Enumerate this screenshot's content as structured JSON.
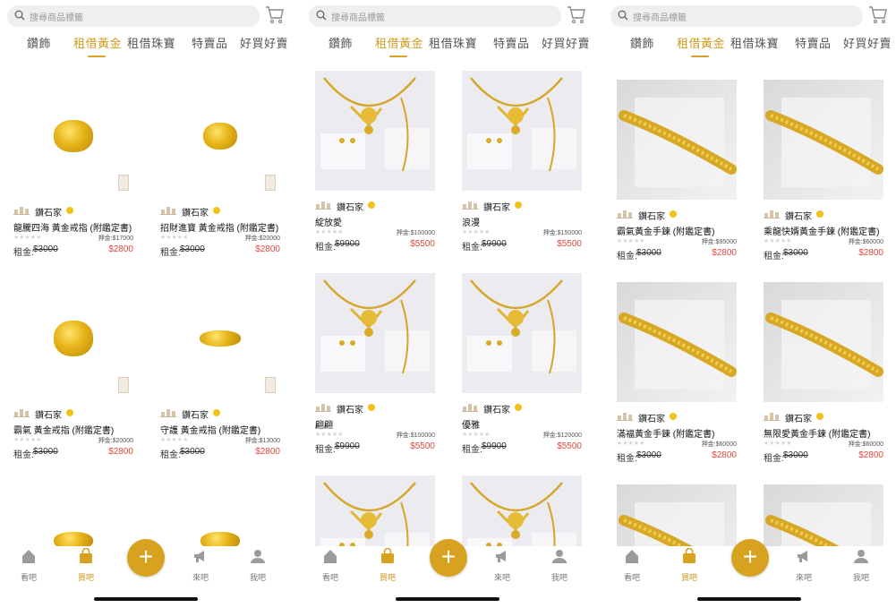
{
  "search": {
    "placeholder": "搜尋商品標籤"
  },
  "tabs": [
    "鑽飾",
    "租借黃金",
    "租借珠寶",
    "特賣品",
    "好買好賣"
  ],
  "active_tab_index": 1,
  "nav": {
    "items": [
      "看吧",
      "買吧",
      "來吧",
      "我吧"
    ],
    "fab_label": "+",
    "active_index": 1
  },
  "labels": {
    "rent": "租金:",
    "deposit_prefix": "押金:"
  },
  "colors": {
    "accent": "#d7a21f",
    "price_new": "#e0473f"
  },
  "panels": [
    {
      "cards": [
        {
          "shop": "鑽石家",
          "name": "龍騰四海 黃金戒指 (附鑑定書)",
          "deposit": "押金:$17000",
          "old_price": "$3000",
          "new_price": "$2800"
        },
        {
          "shop": "鑽石家",
          "name": "招財進寶 黃金戒指 (附鑑定書)",
          "deposit": "押金:$20000",
          "old_price": "$3000",
          "new_price": "$2800"
        },
        {
          "shop": "鑽石家",
          "name": "霸氣 黃金戒指 (附鑑定書)",
          "deposit": "押金:$20000",
          "old_price": "$3000",
          "new_price": "$2800"
        },
        {
          "shop": "鑽石家",
          "name": "守護 黃金戒指 (附鑑定書)",
          "deposit": "押金:$13000",
          "old_price": "$3000",
          "new_price": "$2800"
        }
      ]
    },
    {
      "cards": [
        {
          "shop": "鑽石家",
          "name": "綻放愛",
          "deposit": "押金:$100000",
          "old_price": "$9900",
          "new_price": "$5500"
        },
        {
          "shop": "鑽石家",
          "name": "浪漫",
          "deposit": "押金:$150000",
          "old_price": "$9900",
          "new_price": "$5500"
        },
        {
          "shop": "鑽石家",
          "name": "翩翩",
          "deposit": "押金:$100000",
          "old_price": "$9900",
          "new_price": "$5500"
        },
        {
          "shop": "鑽石家",
          "name": "優雅",
          "deposit": "押金:$120000",
          "old_price": "$9900",
          "new_price": "$5500"
        }
      ]
    },
    {
      "cards": [
        {
          "shop": "鑽石家",
          "name": "霸氣黃金手鍊 (附鑑定書)",
          "deposit": "押金:$95000",
          "old_price": "$3000",
          "new_price": "$2800"
        },
        {
          "shop": "鑽石家",
          "name": "乘龍快婿黃金手鍊 (附鑑定書)",
          "deposit": "押金:$60000",
          "old_price": "$3000",
          "new_price": "$2800"
        },
        {
          "shop": "鑽石家",
          "name": "滿福黃金手鍊 (附鑑定書)",
          "deposit": "押金:$60000",
          "old_price": "$3000",
          "new_price": "$2800"
        },
        {
          "shop": "鑽石家",
          "name": "無限愛黃金手鍊 (附鑑定書)",
          "deposit": "押金:$60000",
          "old_price": "$3000",
          "new_price": "$2800"
        }
      ]
    }
  ]
}
